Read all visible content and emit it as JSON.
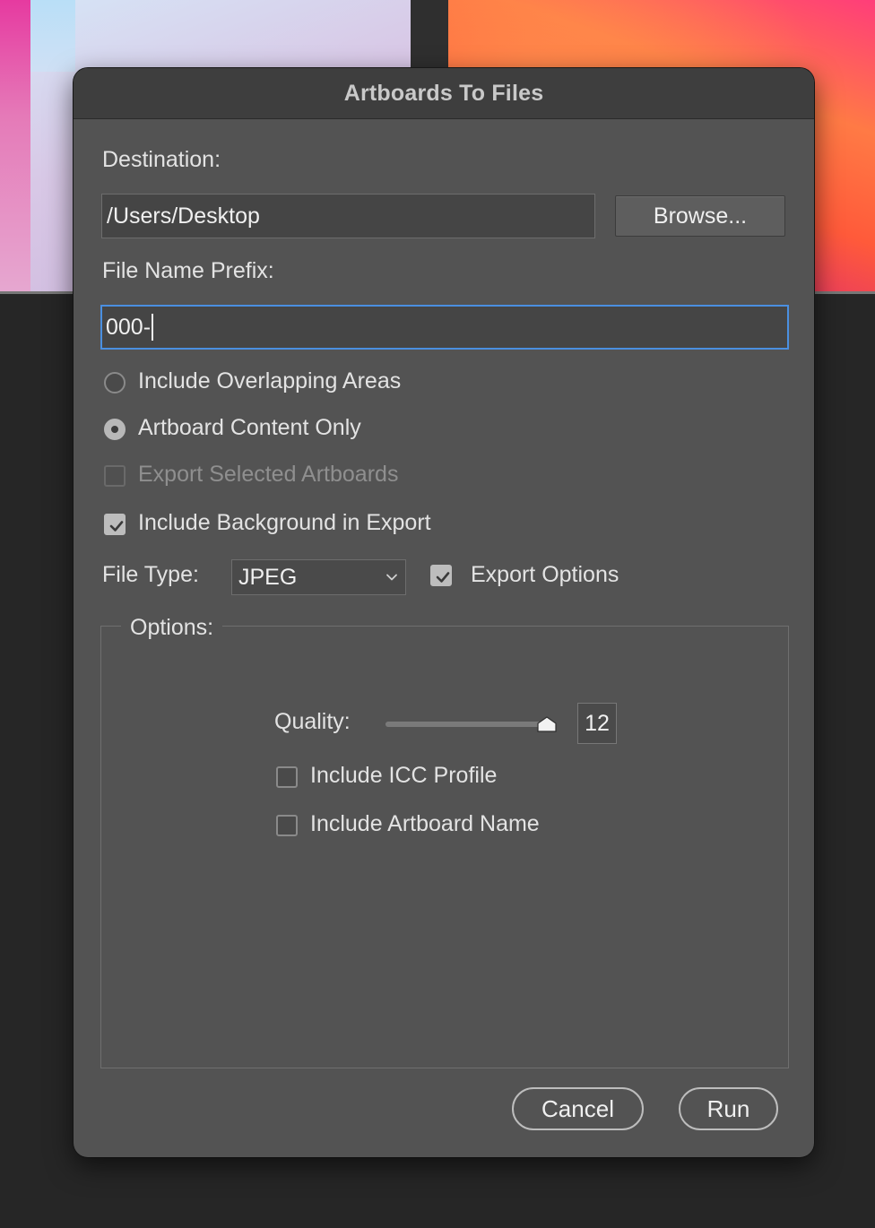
{
  "dialog": {
    "title": "Artboards To Files",
    "destination_label": "Destination:",
    "destination_value": "/Users/Desktop",
    "browse_label": "Browse...",
    "prefix_label": "File Name Prefix:",
    "prefix_value": "000-",
    "radio_overlapping": {
      "label": "Include Overlapping Areas",
      "checked": false
    },
    "radio_content_only": {
      "label": "Artboard Content Only",
      "checked": true
    },
    "export_selected": {
      "label": "Export Selected Artboards",
      "checked": false,
      "enabled": false
    },
    "include_background": {
      "label": "Include Background in Export",
      "checked": true
    },
    "file_type_label": "File Type:",
    "file_type_value": "JPEG",
    "export_options": {
      "label": "Export Options",
      "checked": true
    },
    "options_group_label": "Options:",
    "quality": {
      "label": "Quality:",
      "value": "12",
      "min": 0,
      "max": 12
    },
    "icc_profile": {
      "label": "Include ICC Profile",
      "checked": false
    },
    "artboard_name": {
      "label": "Include Artboard Name",
      "checked": false
    },
    "cancel_label": "Cancel",
    "run_label": "Run"
  },
  "colors": {
    "dialog_bg": "#535353",
    "titlebar_bg": "#3e3e3e",
    "focus_ring": "#4a8fe0"
  }
}
